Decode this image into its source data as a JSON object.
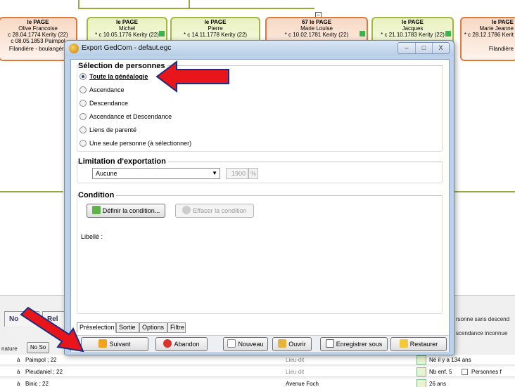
{
  "tree": {
    "boxes": [
      {
        "name": "le PAGE",
        "first": "Olive Francoise",
        "line1": "c 28.04.1774 Kerity (22)",
        "line2": "c 08.05.1853 Paimpol",
        "extra": "Filandière - boulangère"
      },
      {
        "name": "le PAGE",
        "first": "Michel",
        "line1": "* c 10.05.1776 Kerity (22)",
        "line2": "",
        "extra": ""
      },
      {
        "name": "le PAGE",
        "first": "Pierre",
        "line1": "* c 14.11.1778 Kerity (22)",
        "line2": "",
        "extra": ""
      },
      {
        "name": "67 le PAGE",
        "first": "Marie Louise",
        "line1": "* c 10.02.1781 Kerity (22)",
        "line2": "",
        "extra": ""
      },
      {
        "name": "le PAGE",
        "first": "Jacques",
        "line1": "* c 21.10.1783 Kerity (22)",
        "line2": "",
        "extra": ""
      },
      {
        "name": "le PAGE",
        "first": "Marie Jeanne",
        "line1": "* c 28.12.1786 Kerit",
        "line2": "",
        "extra": "Filandière"
      }
    ],
    "collapse_symbol": "−"
  },
  "dialog": {
    "title": "Export GedCom - defaut.egc",
    "window_buttons": {
      "minimize": "–",
      "maximize": "□",
      "close": "X"
    },
    "selection": {
      "title": "Sélection de personnes",
      "options": [
        {
          "label": "Toute la généalogie",
          "checked": true
        },
        {
          "label": "Ascendance",
          "checked": false
        },
        {
          "label": "Descendance",
          "checked": false
        },
        {
          "label": "Ascendance et Descendance",
          "checked": false
        },
        {
          "label": "Liens de parenté",
          "checked": false
        },
        {
          "label": "Une seule personne (à sélectionner)",
          "checked": false
        }
      ]
    },
    "limitation": {
      "title": "Limitation d'exportation",
      "select_value": "Aucune",
      "year_value": "1900",
      "pct_label": "%"
    },
    "condition": {
      "title": "Condition",
      "define_button": "Définir la condition...",
      "clear_button": "Effacer la condition",
      "libelle_label": "Libellé :"
    },
    "tabs": [
      "Préselection",
      "Sortie",
      "Options",
      "Filtre"
    ],
    "footer": {
      "next": "Suivant",
      "abort": "Abandon",
      "new": "Nouveau",
      "open": "Ouvrir",
      "save_as": "Enregistrer sous",
      "restore": "Restaurer"
    }
  },
  "background": {
    "tab_left1": "No",
    "tab_left2": "Rel",
    "col_label": "nature",
    "no_so_button": "No So",
    "rows": [
      {
        "prefix": "à",
        "place": "Paimpol ; 22",
        "type": "Lieu-dit",
        "right": "Né il y a 134 ans"
      },
      {
        "prefix": "à",
        "place": "Pleudaniel ; 22",
        "type": "Lieu-dit",
        "right": "Nb enf. 5"
      },
      {
        "prefix": "à",
        "place": "Binic ; 22",
        "type": "Avenue Foch",
        "right": "26 ans"
      }
    ],
    "right_texts": [
      "rsonne sans descend",
      "scendance inconnue"
    ],
    "persons_label": "Personnes f"
  },
  "colors": {
    "male_border": "#a3b73a",
    "female_border": "#e07a3a",
    "dialog_frame": "#bcd2ea",
    "annotation_red": "#e8151b"
  }
}
